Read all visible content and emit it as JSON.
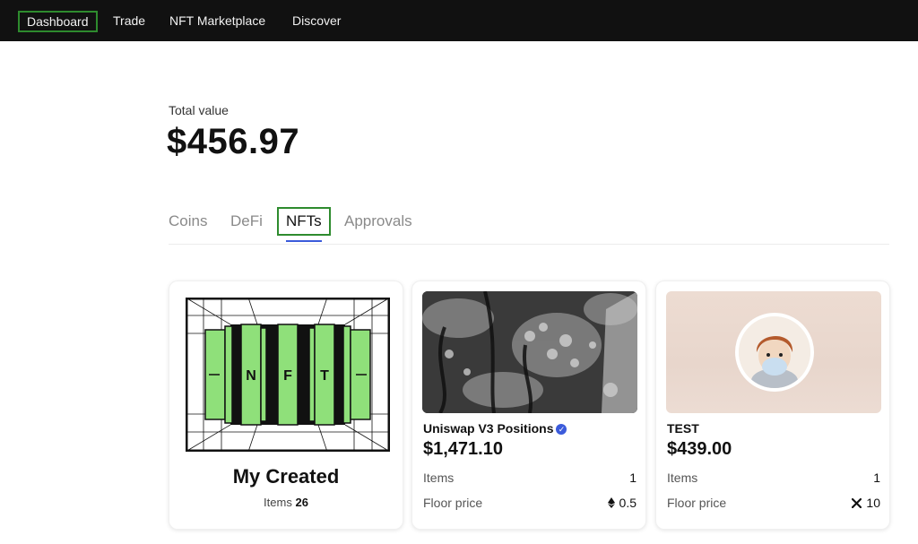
{
  "nav": {
    "items": [
      {
        "label": "Dashboard"
      },
      {
        "label": "Trade"
      },
      {
        "label": "NFT Marketplace"
      },
      {
        "label": "Discover"
      }
    ]
  },
  "summary": {
    "label": "Total value",
    "amount": "$456.97"
  },
  "tabs": [
    {
      "label": "Coins"
    },
    {
      "label": "DeFi"
    },
    {
      "label": "NFTs"
    },
    {
      "label": "Approvals"
    }
  ],
  "cards": {
    "my_created": {
      "title": "My Created",
      "items_label": "Items",
      "items_count": "26",
      "art_letters": [
        "N",
        "F",
        "T"
      ],
      "art_color": "#8fe07a"
    },
    "uniswap": {
      "title": "Uniswap V3 Positions",
      "verified_icon": "✓",
      "price": "$1,471.10",
      "items_label": "Items",
      "items_value": "1",
      "floor_label": "Floor price",
      "floor_value": "0.5",
      "floor_icon": "ethereum-icon"
    },
    "test": {
      "title": "TEST",
      "price": "$439.00",
      "items_label": "Items",
      "items_value": "1",
      "floor_label": "Floor price",
      "floor_value": "10",
      "floor_icon": "x-token-icon"
    }
  },
  "colors": {
    "highlight": "#2e8b2e",
    "tab_underline": "#3b5bdb",
    "nav_bg": "#111111"
  }
}
